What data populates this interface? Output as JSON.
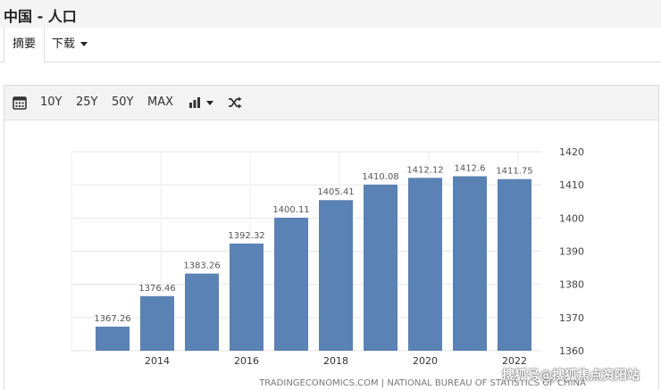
{
  "header": {
    "title": "中国 - 人口"
  },
  "tabs": [
    {
      "label": "摘要"
    },
    {
      "label": "下载"
    }
  ],
  "toolbar": {
    "icons": [
      "calendar-icon",
      "bar-chart-icon",
      "shuffle-icon"
    ],
    "ranges": [
      "10Y",
      "25Y",
      "50Y",
      "MAX"
    ]
  },
  "colors": {
    "bar": "#5a82b4",
    "grid": "#e6e6e6",
    "label": "#555555"
  },
  "chart_data": {
    "type": "bar",
    "categories": [
      "2014",
      "2015",
      "2016",
      "2017",
      "2018",
      "2019",
      "2020",
      "2021",
      "2022"
    ],
    "values": [
      1367.26,
      1376.46,
      1383.26,
      1392.32,
      1400.11,
      1405.41,
      1410.08,
      1412.12,
      1412.6,
      1411.75
    ],
    "x_tick_labels": [
      "2014",
      "2016",
      "2018",
      "2020",
      "2022"
    ],
    "y_ticks": [
      1360,
      1370,
      1380,
      1390,
      1400,
      1410,
      1420
    ],
    "ylim": [
      1360,
      1420
    ],
    "ylabel": "",
    "xlabel": "",
    "title": "",
    "grid": true,
    "source": "TRADINGECONOMICS.COM | NATIONAL BUREAU OF STATISTICS OF CHINA"
  },
  "watermark": "搜狐号@搜狐焦点资阳站"
}
